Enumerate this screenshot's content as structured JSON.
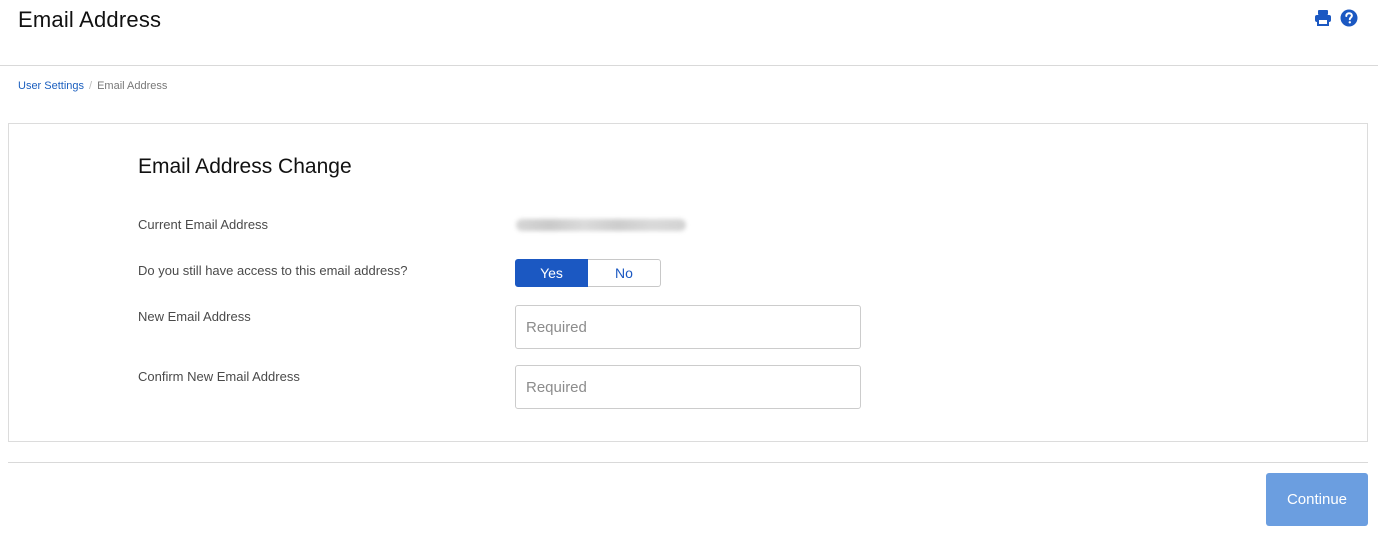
{
  "header": {
    "title": "Email Address",
    "icons": [
      "print-icon",
      "help-icon"
    ],
    "icon_color": "#1b58c2"
  },
  "breadcrumb": {
    "link_label": "User Settings",
    "separator": "/",
    "current": "Email Address"
  },
  "form": {
    "title": "Email Address Change",
    "current_email_label": "Current Email Address",
    "access_question_label": "Do you still have access to this email address?",
    "access_toggle": {
      "yes_label": "Yes",
      "no_label": "No",
      "selected": "Yes"
    },
    "new_email_label": "New Email Address",
    "new_email_placeholder": "Required",
    "confirm_email_label": "Confirm New Email Address",
    "confirm_email_placeholder": "Required"
  },
  "footer": {
    "continue_label": "Continue",
    "continue_color": "#6b9ee0"
  },
  "colors": {
    "accent": "#1b58c2",
    "link": "#1b5fbf"
  }
}
